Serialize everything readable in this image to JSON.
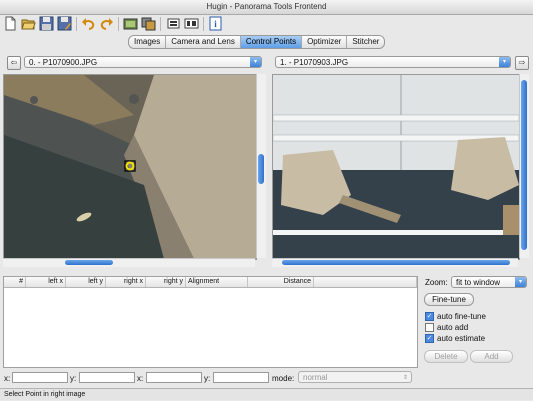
{
  "window": {
    "title": "Hugin - Panorama Tools Frontend"
  },
  "toolbar": {
    "buttons": [
      "new-icon",
      "open-icon",
      "save-icon",
      "save-as-icon",
      "undo-icon",
      "redo-icon",
      "assistant-icon",
      "batch-icon",
      "show-preview-icon",
      "show-layout-icon",
      "info-icon"
    ]
  },
  "tabs": [
    {
      "label": "Images",
      "active": false
    },
    {
      "label": "Camera and Lens",
      "active": false
    },
    {
      "label": "Control Points",
      "active": true
    },
    {
      "label": "Optimizer",
      "active": false
    },
    {
      "label": "Stitcher",
      "active": false
    }
  ],
  "left_image": {
    "selected": "0. - P1070900.JPG"
  },
  "right_image": {
    "selected": "1. - P1070903.JPG"
  },
  "table": {
    "columns": [
      "#",
      "left x",
      "left y",
      "right x",
      "right y",
      "Alignment",
      "Distance"
    ],
    "rows": []
  },
  "fields": {
    "x1_label": "x:",
    "y1_label": "y:",
    "x2_label": "x:",
    "y2_label": "y:",
    "mode_label": "mode:",
    "mode_value": "normal"
  },
  "zoom": {
    "label": "Zoom:",
    "value": "fit to window"
  },
  "buttons": {
    "fine_tune": "Fine-tune",
    "delete": "Delete",
    "add": "Add"
  },
  "options": [
    {
      "label": "auto fine-tune",
      "checked": true
    },
    {
      "label": "auto add",
      "checked": false
    },
    {
      "label": "auto estimate",
      "checked": true
    }
  ],
  "status": {
    "text": "Select Point in right image"
  },
  "colors": {
    "accent": "#3d82d8",
    "control_point": "#f2e600"
  }
}
